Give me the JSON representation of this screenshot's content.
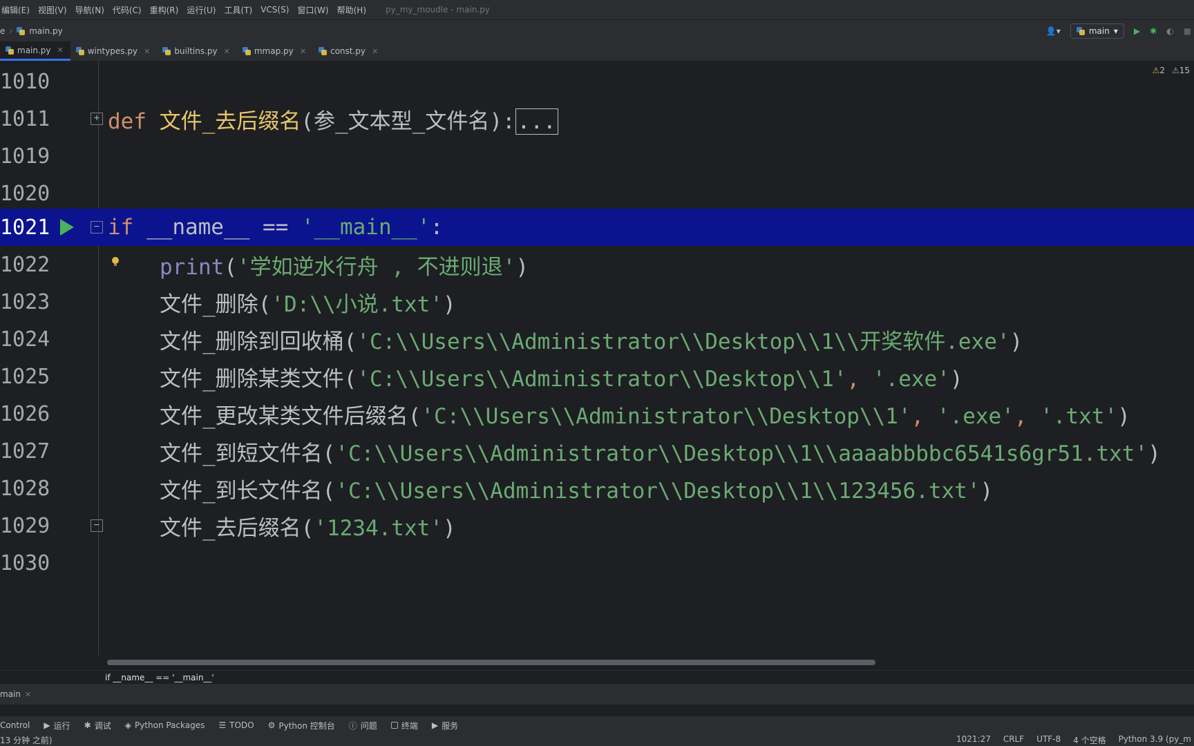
{
  "menu": {
    "items": [
      "编辑(E)",
      "视图(V)",
      "导航(N)",
      "代码(C)",
      "重构(R)",
      "运行(U)",
      "工具(T)",
      "VCS(S)",
      "窗口(W)",
      "帮助(H)"
    ],
    "window_title": "py_my_moudle - main.py"
  },
  "nav": {
    "crumb_project": "e",
    "crumb_file": "main.py",
    "run_config": "main"
  },
  "tabs": [
    "main.py",
    "wintypes.py",
    "builtins.py",
    "mmap.py",
    "const.py"
  ],
  "inspections": {
    "warnings": "2",
    "weak_warnings": "15"
  },
  "code": {
    "line_numbers": [
      "1010",
      "1011",
      "1019",
      "1020",
      "1021",
      "1022",
      "1023",
      "1024",
      "1025",
      "1026",
      "1027",
      "1028",
      "1029",
      "1030"
    ],
    "l1011": {
      "kw": "def",
      "name": "文件_去后缀名",
      "params": "(参_文本型_文件名):",
      "folded": "..."
    },
    "l1021": {
      "kw": "if",
      "rest": " __name__ == ",
      "str": "'__main__'",
      "end": ":"
    },
    "l1022": {
      "fn": "print",
      "open": "(",
      "str": "'学如逆水行舟 , 不进则退'",
      "close": ")"
    },
    "l1023": {
      "call": "文件_删除(",
      "str": "'D:\\\\小说.txt'",
      "close": ")"
    },
    "l1024": {
      "call": "文件_删除到回收桶(",
      "str": "'C:\\\\Users\\\\Administrator\\\\Desktop\\\\1\\\\开奖软件.exe'",
      "close": ")"
    },
    "l1025": {
      "call": "文件_删除某类文件(",
      "str1": "'C:\\\\Users\\\\Administrator\\\\Desktop\\\\1'",
      "sep": ", ",
      "str2": "'.exe'",
      "close": ")"
    },
    "l1026": {
      "call": "文件_更改某类文件后缀名(",
      "str1": "'C:\\\\Users\\\\Administrator\\\\Desktop\\\\1'",
      "sep1": ", ",
      "str2": "'.exe'",
      "sep2": ", ",
      "str3": "'.txt'",
      "close": ")"
    },
    "l1027": {
      "call": "文件_到短文件名(",
      "str": "'C:\\\\Users\\\\Administrator\\\\Desktop\\\\1\\\\aaaabbbbc6541s6gr51.txt'",
      "close": ")"
    },
    "l1028": {
      "call": "文件_到长文件名(",
      "str": "'C:\\\\Users\\\\Administrator\\\\Desktop\\\\1\\\\123456.txt'",
      "close": ")"
    },
    "l1029": {
      "call": "文件_去后缀名(",
      "str": "'1234.txt'",
      "close": ")"
    }
  },
  "breadcrumb_bottom": "if __name__ == '__main__'",
  "run_panel": {
    "tab": "main"
  },
  "tool_windows": [
    "Control",
    "运行",
    "调试",
    "Python Packages",
    "TODO",
    "Python 控制台",
    "问题",
    "终端",
    "服务"
  ],
  "status": {
    "left": "13 分钟 之前)",
    "position": "1021:27",
    "line_sep": "CRLF",
    "encoding": "UTF-8",
    "indent": "4 个空格",
    "interpreter": "Python 3.9 (py_m"
  }
}
